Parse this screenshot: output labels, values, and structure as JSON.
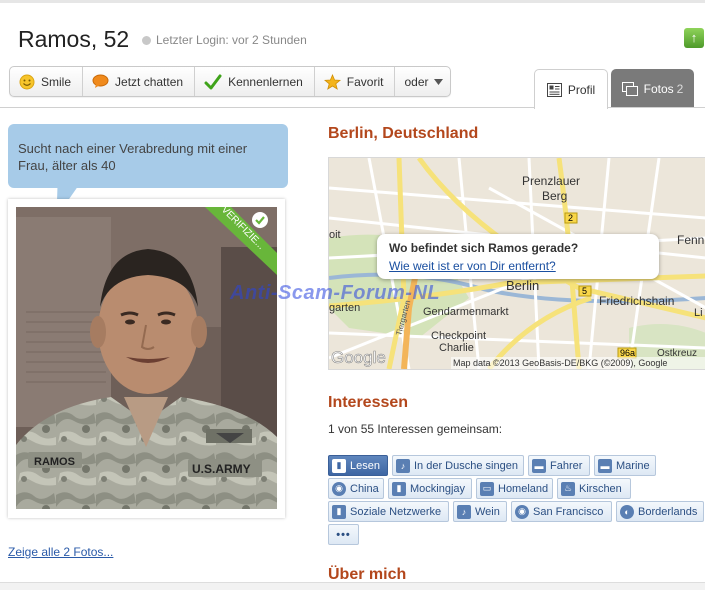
{
  "profile": {
    "name_age": "Ramos, 52",
    "last_login": "Letzter Login: vor 2 Stunden"
  },
  "actions": [
    {
      "label": "Smile",
      "icon": "smiley-icon"
    },
    {
      "label": "Jetzt chatten",
      "icon": "chat-bubble-icon"
    },
    {
      "label": "Kennenlernen",
      "icon": "checkmark-icon"
    },
    {
      "label": "Favorit",
      "icon": "star-icon"
    },
    {
      "label": "oder",
      "icon": "dropdown-arrow-icon"
    }
  ],
  "tabs": {
    "profil": "Profil",
    "fotos": "Fotos",
    "fotos_count": "2"
  },
  "bubble": {
    "text": "Sucht nach einer Verabredung mit einer Frau, älter als 40"
  },
  "photo": {
    "verified_label": "VERIFIZIE..."
  },
  "show_photos": "Zeige alle 2 Fotos...",
  "location": {
    "title": "Berlin, Deutschland"
  },
  "map": {
    "labels": [
      "Prenzlauer",
      "Berg",
      "Fennp",
      "Berlin",
      "Friedrichshain",
      "Gendarmenmarkt",
      "Checkpoint",
      "Charlie",
      "garten",
      "Li",
      "Ostkreuz",
      "oit",
      "Google",
      "Map data ©2013 GeoBasis-DE/BKG (©2009), Google"
    ],
    "road_numbers": [
      "2",
      "2",
      "5",
      "96a",
      "Tiergarten"
    ],
    "popup_question": "Wo befindet sich Ramos gerade?",
    "popup_link": "Wie weit ist er von Dir entfernt?"
  },
  "watermark": "Anti-Scam-Forum-NL",
  "interests": {
    "title": "Interessen",
    "subtitle": "1 von 55 Interessen gemeinsam:",
    "tags": [
      {
        "label": "Lesen",
        "icon": "book-icon",
        "selected": true
      },
      {
        "label": "In der Dusche singen",
        "icon": "guitar-icon",
        "selected": false
      },
      {
        "label": "Fahrer",
        "icon": "briefcase-icon",
        "selected": false
      },
      {
        "label": "Marine",
        "icon": "briefcase-icon",
        "selected": false
      },
      {
        "label": "China",
        "icon": "globe-icon",
        "selected": false
      },
      {
        "label": "Mockingjay",
        "icon": "book-icon",
        "selected": false
      },
      {
        "label": "Homeland",
        "icon": "tv-icon",
        "selected": false
      },
      {
        "label": "Kirschen",
        "icon": "food-icon",
        "selected": false
      },
      {
        "label": "Soziale Netzwerke",
        "icon": "book-icon",
        "selected": false
      },
      {
        "label": "Wein",
        "icon": "guitar-icon",
        "selected": false
      },
      {
        "label": "San Francisco",
        "icon": "globe-icon",
        "selected": false
      },
      {
        "label": "Borderlands",
        "icon": "game-icon",
        "selected": false
      }
    ],
    "more": "•••"
  },
  "about_title": "Über mich",
  "colors": {
    "heading": "#b3471c",
    "bubble": "#a7cbe8",
    "link": "#2a5aa8",
    "tag_selected": "#3e66a3"
  }
}
